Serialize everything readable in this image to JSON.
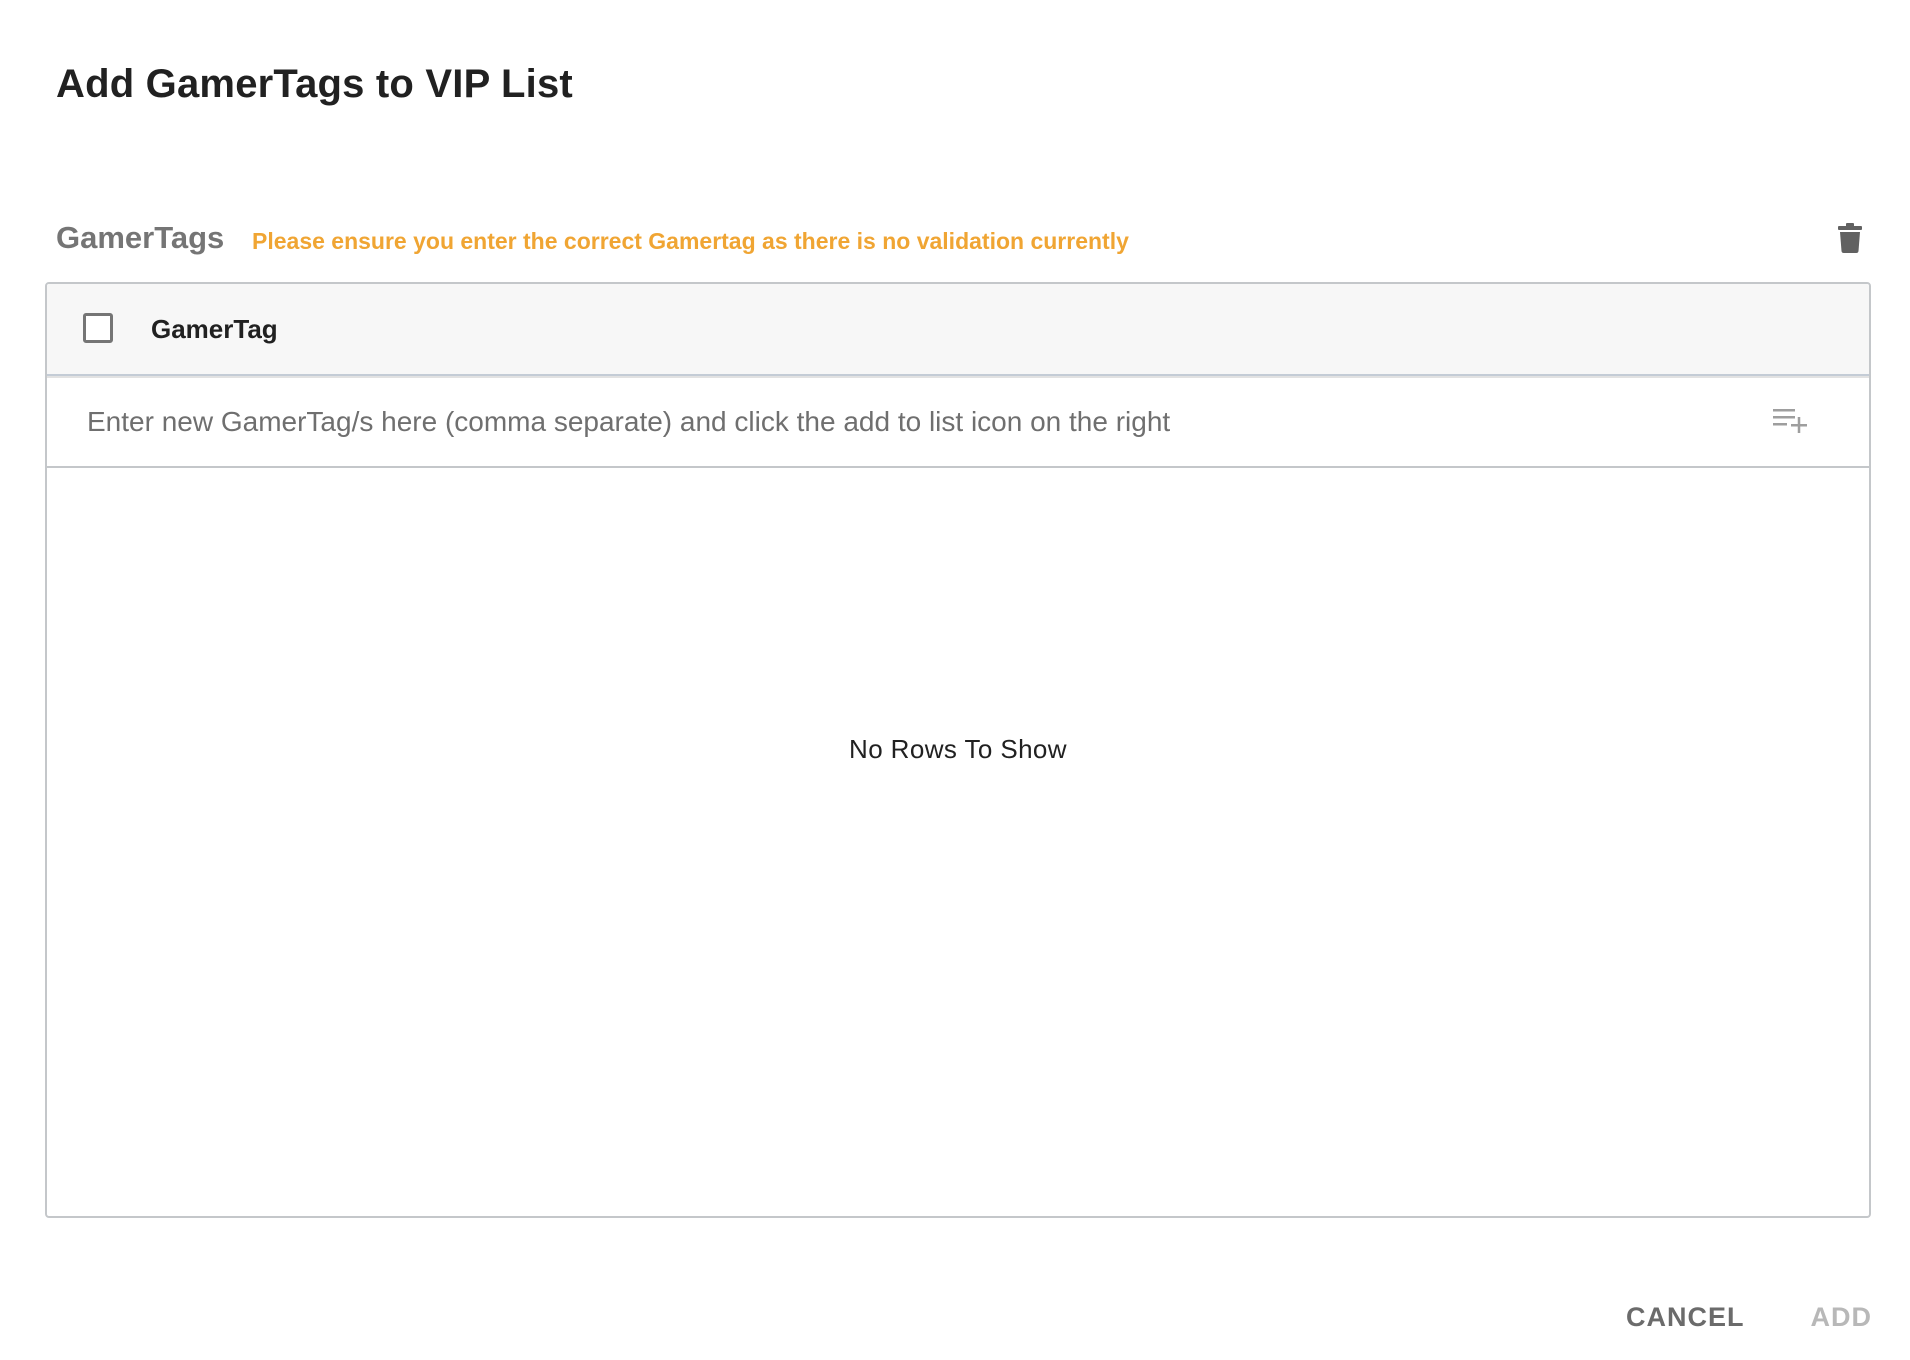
{
  "dialog": {
    "title": "Add GamerTags to VIP List"
  },
  "section": {
    "label": "GamerTags",
    "warning": "Please ensure you enter the correct Gamertag as there is no validation currently",
    "delete_icon": "trash-icon",
    "warning_color": "#f0a533"
  },
  "grid": {
    "column_header": "GamerTag",
    "select_all_checked": false,
    "input": {
      "value": "",
      "placeholder": "Enter new GamerTag/s here (comma separate) and click the add to list icon on the right"
    },
    "add_icon": "playlist-add-icon",
    "empty_message": "No Rows To Show",
    "rows": []
  },
  "actions": {
    "cancel_label": "CANCEL",
    "add_label": "ADD",
    "add_disabled": true
  }
}
